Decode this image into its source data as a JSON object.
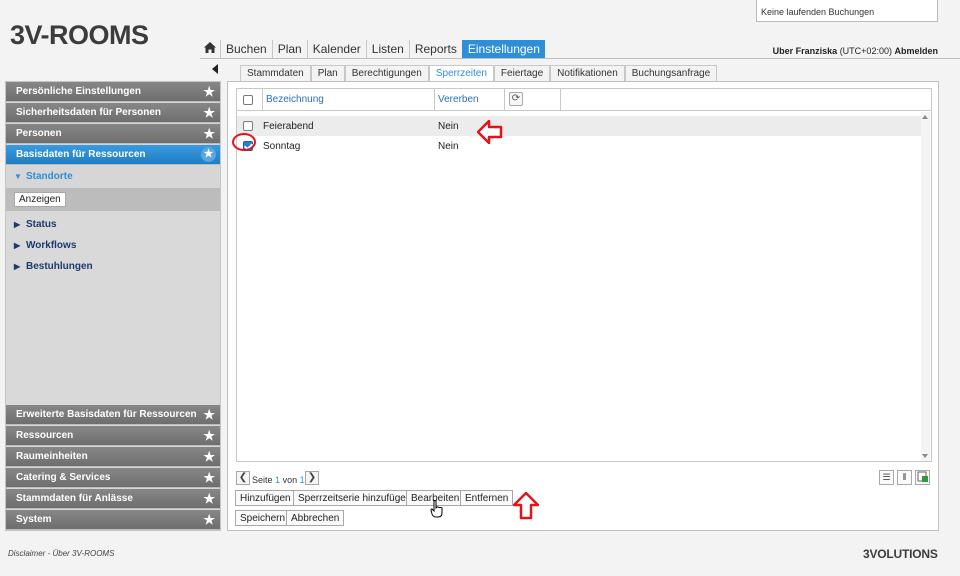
{
  "app": {
    "logo": "3V-ROOMS",
    "booking_status": "Keine laufenden Buchungen",
    "user": "Uber Franziska",
    "timezone": "(UTC+02:00)",
    "logout": "Abmelden"
  },
  "nav": {
    "items": [
      "Buchen",
      "Plan",
      "Kalender",
      "Listen",
      "Reports",
      "Einstellungen"
    ],
    "active": "Einstellungen"
  },
  "sidebar": {
    "top": [
      "Persönliche Einstellungen",
      "Sicherheitsdaten für Personen",
      "Personen",
      "Basisdaten für Ressourcen"
    ],
    "sub": [
      "Standorte",
      "Status",
      "Workflows",
      "Bestuhlungen"
    ],
    "anzeigen": "Anzeigen",
    "bottom": [
      "Erweiterte Basisdaten für Ressourcen",
      "Ressourcen",
      "Raumeinheiten",
      "Catering & Services",
      "Stammdaten für Anlässe",
      "System"
    ]
  },
  "subtabs": [
    "Stammdaten",
    "Plan",
    "Berechtigungen",
    "Sperrzeiten",
    "Feiertage",
    "Notifikationen",
    "Buchungsanfrage"
  ],
  "grid": {
    "col_name": "Bezeichnung",
    "col_inherit": "Vererben",
    "rows": [
      {
        "name": "Feierabend",
        "inherit": "Nein"
      },
      {
        "name": "Sonntag",
        "inherit": "Nein"
      }
    ]
  },
  "pager": {
    "page_label": "Seite",
    "page": "1",
    "of_label": "von",
    "total": "1"
  },
  "buttons": {
    "add": "Hinzufügen",
    "add_series": "Sperrzeitserie hinzufügen",
    "edit": "Bearbeiten",
    "remove": "Entfernen",
    "save": "Speichern",
    "cancel": "Abbrechen"
  },
  "footer": {
    "disclaimer": "Disclaimer",
    "separator": "-",
    "about": "Über 3V-ROOMS",
    "brand": "3VOLUTIONS"
  },
  "colors": {
    "accent": "#2e8fd6",
    "sidebar_header": "#7a7a7a",
    "annotation": "#e0161b"
  }
}
